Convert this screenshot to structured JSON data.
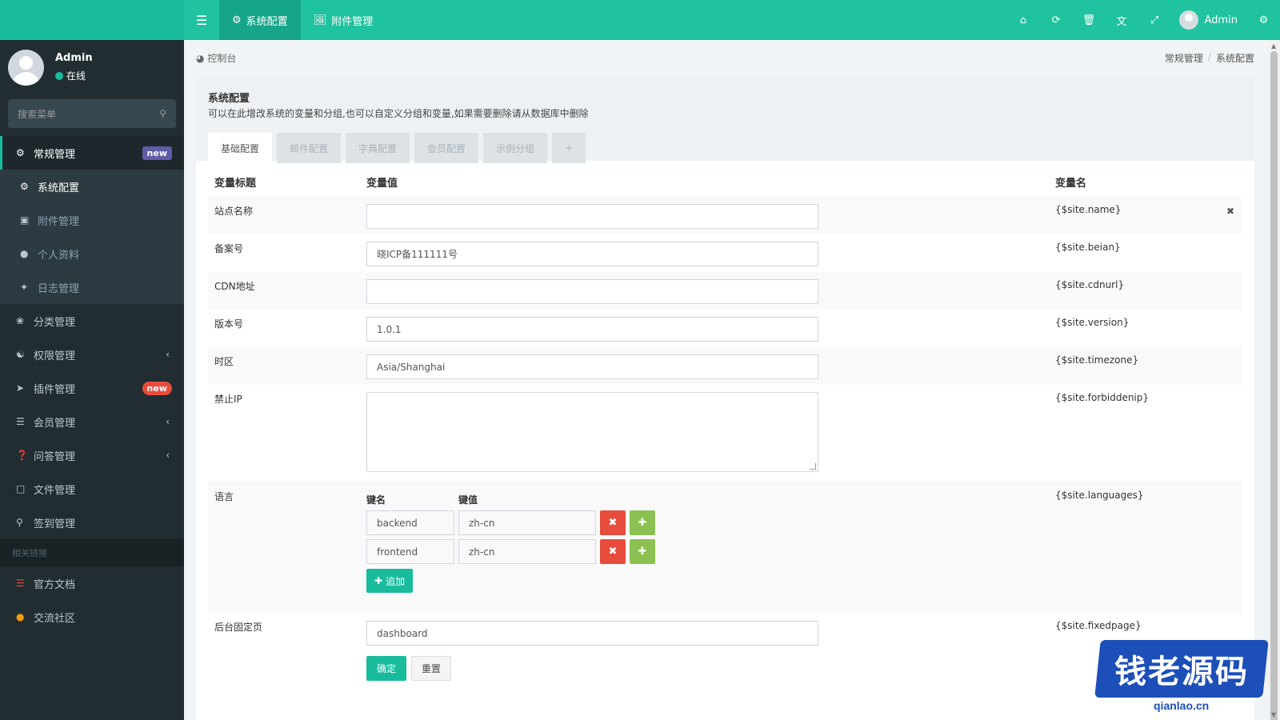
{
  "header": {
    "tabs": [
      {
        "label": "系统配置",
        "icon": "gear-icon",
        "active": true
      },
      {
        "label": "附件管理",
        "icon": "file-image-icon",
        "active": false
      }
    ],
    "user_name": "Admin",
    "tools": [
      "home-icon",
      "refresh-icon",
      "trash-icon",
      "translate-icon",
      "fullscreen-icon",
      "settings-icon"
    ]
  },
  "sidebar": {
    "user": {
      "name": "Admin",
      "status": "在线"
    },
    "search_placeholder": "搜索菜单",
    "group_main": {
      "label": "常规管理",
      "badge": "new"
    },
    "sub_items": [
      {
        "label": "系统配置",
        "icon": "gear-icon"
      },
      {
        "label": "附件管理",
        "icon": "file-image-icon"
      },
      {
        "label": "个人资料",
        "icon": "user-icon"
      },
      {
        "label": "日志管理",
        "icon": "log-icon"
      }
    ],
    "items": [
      {
        "label": "分类管理",
        "icon": "leaf-icon"
      },
      {
        "label": "权限管理",
        "icon": "group-icon"
      },
      {
        "label": "插件管理",
        "icon": "rocket-icon",
        "badge": "new"
      },
      {
        "label": "会员管理",
        "icon": "list-icon"
      },
      {
        "label": "问答管理",
        "icon": "question-icon"
      },
      {
        "label": "文件管理",
        "icon": "folder-icon"
      },
      {
        "label": "签到管理",
        "icon": "map-marker-icon"
      }
    ],
    "section_header": "相关链接",
    "links": [
      {
        "label": "官方文档",
        "icon": "list-icon"
      },
      {
        "label": "交流社区",
        "icon": "comment-icon"
      }
    ]
  },
  "breadcrumb": {
    "left": "控制台",
    "right": [
      "常规管理",
      "系统配置"
    ]
  },
  "panel": {
    "title": "系统配置",
    "description": "可以在此增改系统的变量和分组,也可以自定义分组和变量,如果需要删除请从数据库中删除",
    "tabs": [
      "基础配置",
      "邮件配置",
      "字典配置",
      "会员配置",
      "示例分组",
      "+"
    ]
  },
  "table": {
    "headers": {
      "title": "变量标题",
      "value": "变量值",
      "name": "变量名"
    },
    "rows": {
      "site_name": {
        "title": "站点名称",
        "value": "",
        "var": "{$site.name}"
      },
      "beian": {
        "title": "备案号",
        "value": "晓ICP备111111号",
        "var": "{$site.beian}"
      },
      "cdn": {
        "title": "CDN地址",
        "value": "",
        "var": "{$site.cdnurl}"
      },
      "version": {
        "title": "版本号",
        "value": "1.0.1",
        "var": "{$site.version}"
      },
      "timezone": {
        "title": "时区",
        "value": "Asia/Shanghai",
        "var": "{$site.timezone}"
      },
      "forbidden": {
        "title": "禁止IP",
        "value": "",
        "var": "{$site.forbiddenip}"
      },
      "languages": {
        "title": "语言",
        "var": "{$site.languages}",
        "key_header": "键名",
        "val_header": "键值",
        "pairs": [
          {
            "key": "backend",
            "value": "zh-cn"
          },
          {
            "key": "frontend",
            "value": "zh-cn"
          }
        ],
        "add_label": "追加"
      },
      "fixedpage": {
        "title": "后台固定页",
        "value": "dashboard",
        "var": "{$site.fixedpage}"
      }
    }
  },
  "actions": {
    "confirm": "确定",
    "reset": "重置"
  },
  "watermark": {
    "text": "钱老源码",
    "sub": "qianlao.cn"
  },
  "colors": {
    "primary": "#18bc9c",
    "sidebar": "#222d32",
    "danger": "#e74c3c",
    "success": "#8cc152",
    "badge_purple": "#605ca8"
  }
}
